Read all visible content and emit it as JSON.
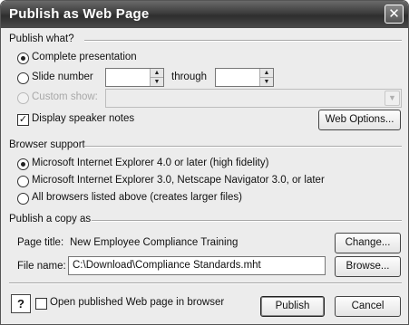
{
  "window": {
    "title": "Publish as Web Page",
    "close_glyph": "✕"
  },
  "publish_what": {
    "heading": "Publish what?",
    "complete_presentation": "Complete presentation",
    "slide_number": "Slide number",
    "through": "through",
    "custom_show": "Custom show:",
    "display_speaker_notes": "Display speaker notes",
    "web_options_button": "Web Options...",
    "selected": "complete_presentation",
    "speaker_notes_checked": true
  },
  "browser_support": {
    "heading": "Browser support",
    "options": [
      "Microsoft Internet Explorer 4.0 or later (high fidelity)",
      "Microsoft Internet Explorer 3.0, Netscape Navigator 3.0, or later",
      "All browsers listed above (creates larger files)"
    ],
    "selected_index": 0
  },
  "publish_copy": {
    "heading": "Publish a copy as",
    "page_title_label": "Page title:",
    "page_title_value": "New Employee Compliance Training",
    "change_button": "Change...",
    "file_name_label": "File name:",
    "file_name_value": "C:\\Download\\Compliance Standards.mht",
    "browse_button": "Browse..."
  },
  "footer": {
    "help_glyph": "?",
    "open_in_browser": "Open published Web page in browser",
    "open_in_browser_checked": false,
    "publish_button": "Publish",
    "cancel_button": "Cancel"
  }
}
